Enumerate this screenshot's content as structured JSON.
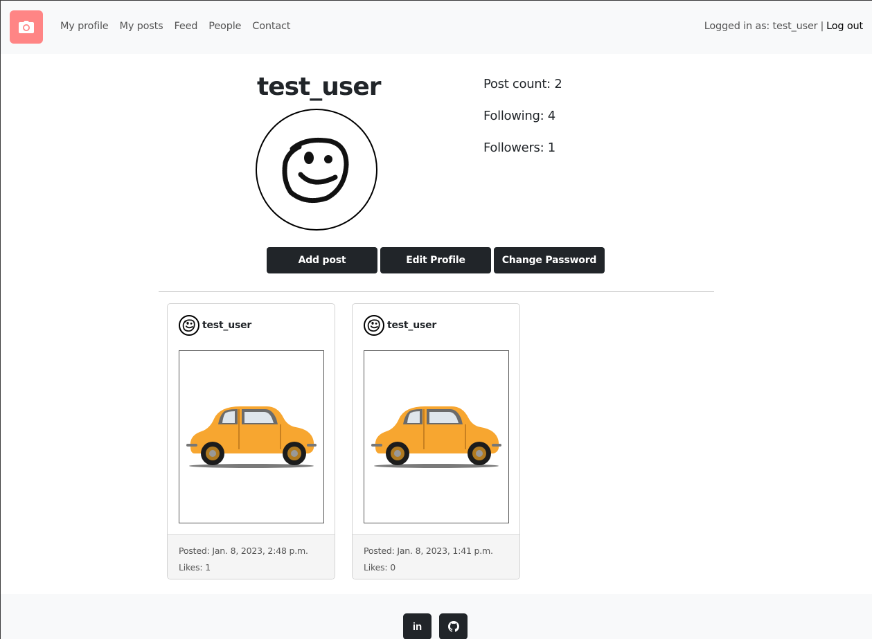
{
  "nav": {
    "brand_icon": "camera-icon",
    "links": [
      "My profile",
      "My posts",
      "Feed",
      "People",
      "Contact"
    ],
    "logged_in_text": "Logged in as: test_user",
    "separator": "|",
    "logout_label": "Log out"
  },
  "profile": {
    "username": "test_user",
    "avatar_icon": "smiley-face-icon",
    "post_count": "Post count: 2",
    "following": "Following: 4",
    "followers": "Followers: 1"
  },
  "actions": {
    "add_post": "Add post",
    "edit_profile": "Edit Profile",
    "change_password": "Change Password"
  },
  "posts": [
    {
      "author": "test_user",
      "image_icon": "yellow-car-icon",
      "posted": "Posted: Jan. 8, 2023, 2:48 p.m.",
      "likes": "Likes: 1"
    },
    {
      "author": "test_user",
      "image_icon": "yellow-car-icon",
      "posted": "Posted: Jan. 8, 2023, 1:41 p.m.",
      "likes": "Likes: 0"
    }
  ],
  "footer": {
    "social": [
      {
        "label": "in",
        "icon": "linkedin-icon"
      },
      {
        "icon": "github-icon"
      }
    ]
  },
  "colors": {
    "brand": "#ff8585",
    "button": "#212529",
    "navbar_bg": "#f8f9fa",
    "car": "#f9a825"
  }
}
